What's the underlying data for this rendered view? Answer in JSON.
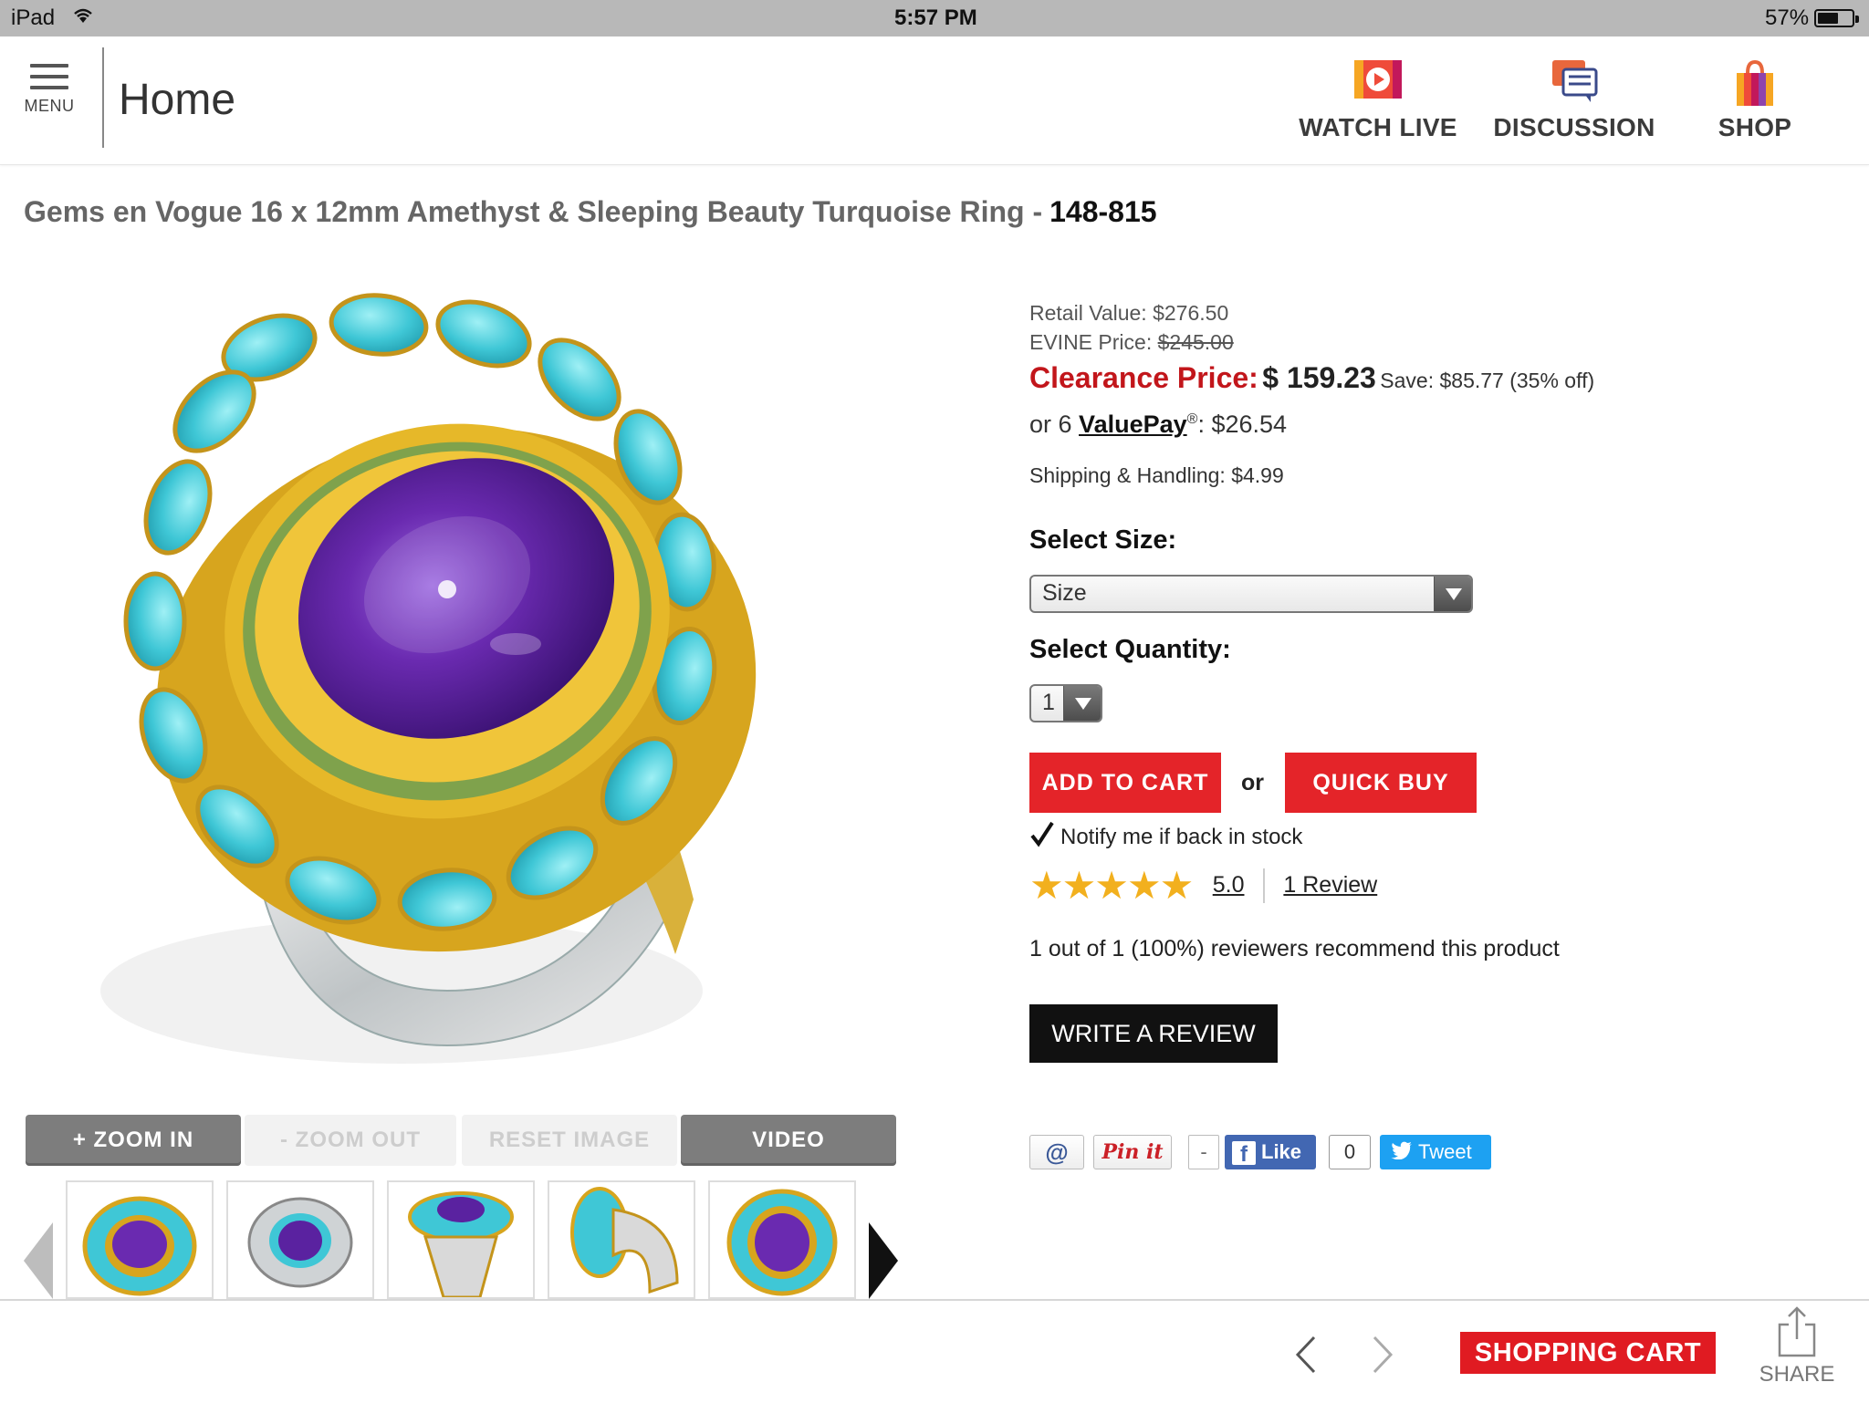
{
  "status": {
    "device": "iPad",
    "time": "5:57 PM",
    "battery": "57%",
    "battery_level": 0.57
  },
  "header": {
    "menu_label": "MENU",
    "title": "Home",
    "nav": [
      {
        "label": "WATCH LIVE",
        "icon": "play-icon"
      },
      {
        "label": "DISCUSSION",
        "icon": "chat-icon"
      },
      {
        "label": "SHOP",
        "icon": "shopping-bag-icon"
      }
    ]
  },
  "product": {
    "title": "Gems en Vogue 16 x 12mm Amethyst & Sleeping Beauty Turquoise Ring -",
    "sku": "148-815"
  },
  "gallery": {
    "zoom_in": "+ ZOOM IN",
    "zoom_out": "- ZOOM OUT",
    "reset": "RESET IMAGE",
    "video": "VIDEO",
    "thumbnail_count": 5
  },
  "pricing": {
    "retail_label": "Retail Value:",
    "retail_value": "$276.50",
    "evine_label": "EVINE Price:",
    "evine_value": "$245.00",
    "clearance_label": "Clearance Price:",
    "clearance_value": "$ 159.23",
    "save": "Save: $85.77 (35% off)",
    "valuepay_or": "or  6",
    "valuepay_label": "ValuePay",
    "valuepay_reg": "®",
    "valuepay_value": ": $26.54",
    "shipping": "Shipping & Handling: $4.99"
  },
  "options": {
    "size_label": "Select Size:",
    "size_value": "Size",
    "qty_label": "Select Quantity:",
    "qty_value": "1"
  },
  "actions": {
    "add_to_cart": "ADD TO CART",
    "or": "or",
    "quick_buy": "QUICK BUY",
    "notify": "Notify me if back in stock",
    "write_review": "WRITE A REVIEW"
  },
  "reviews": {
    "stars": "★★★★★",
    "rating": "5.0",
    "count": "1 Review",
    "recommend": "1 out of 1 (100%) reviewers recommend this product",
    "star_value": 5
  },
  "social": {
    "email": "@",
    "pinit": "Pin it",
    "pin_count": "-",
    "like": "Like",
    "like_count": "0",
    "tweet": "Tweet"
  },
  "bottom": {
    "cart": "SHOPPING CART",
    "share": "SHARE"
  },
  "colors": {
    "accent_red": "#e42429",
    "turquoise": "#3fc7d6",
    "amethyst": "#6a2ab0",
    "gold": "#e2b022"
  }
}
